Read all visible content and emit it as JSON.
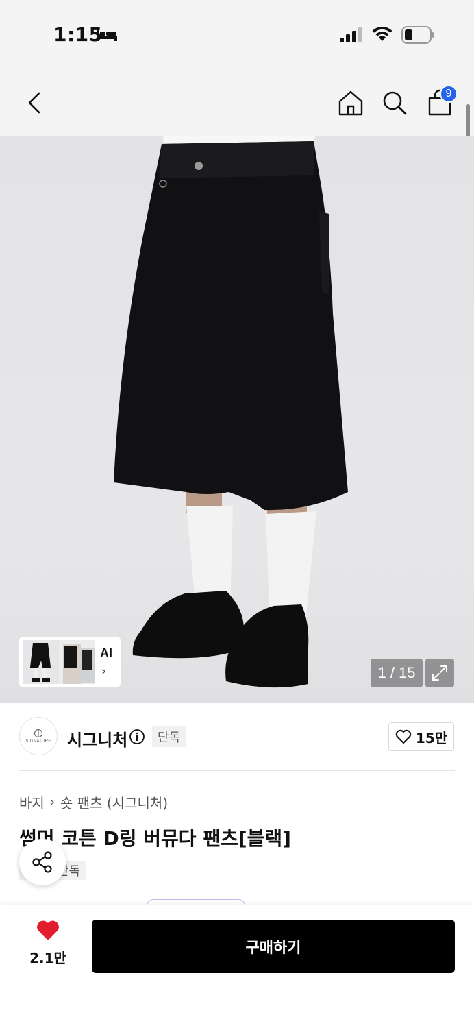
{
  "status_bar": {
    "time": "1:15",
    "icons": [
      "bed-icon",
      "signal-icon",
      "wifi-icon",
      "battery-icon"
    ]
  },
  "header": {
    "icons": [
      "back-icon",
      "home-icon",
      "search-icon",
      "cart-icon"
    ],
    "cart_count": "9",
    "badge_color": "#2563eb"
  },
  "gallery": {
    "ai_label": "AI",
    "counter": "1 / 15",
    "expand_icon": "expand-icon",
    "image_description": "black wide bermuda shorts with white socks and black shoes"
  },
  "brand": {
    "logo_text": "SIGNATURE",
    "name": "시그니처",
    "badge": "단독",
    "likes": "15만"
  },
  "product": {
    "breadcrumb": [
      "바지",
      "숏 팬츠 (시그니처)"
    ],
    "title": "썸머 코튼 D링 버뮤다 팬츠[블랙]",
    "badge": "단독"
  },
  "bottom_bar": {
    "wish_count": "2.1만",
    "heart_color": "#e11d2e",
    "buy_label": "구매하기"
  }
}
